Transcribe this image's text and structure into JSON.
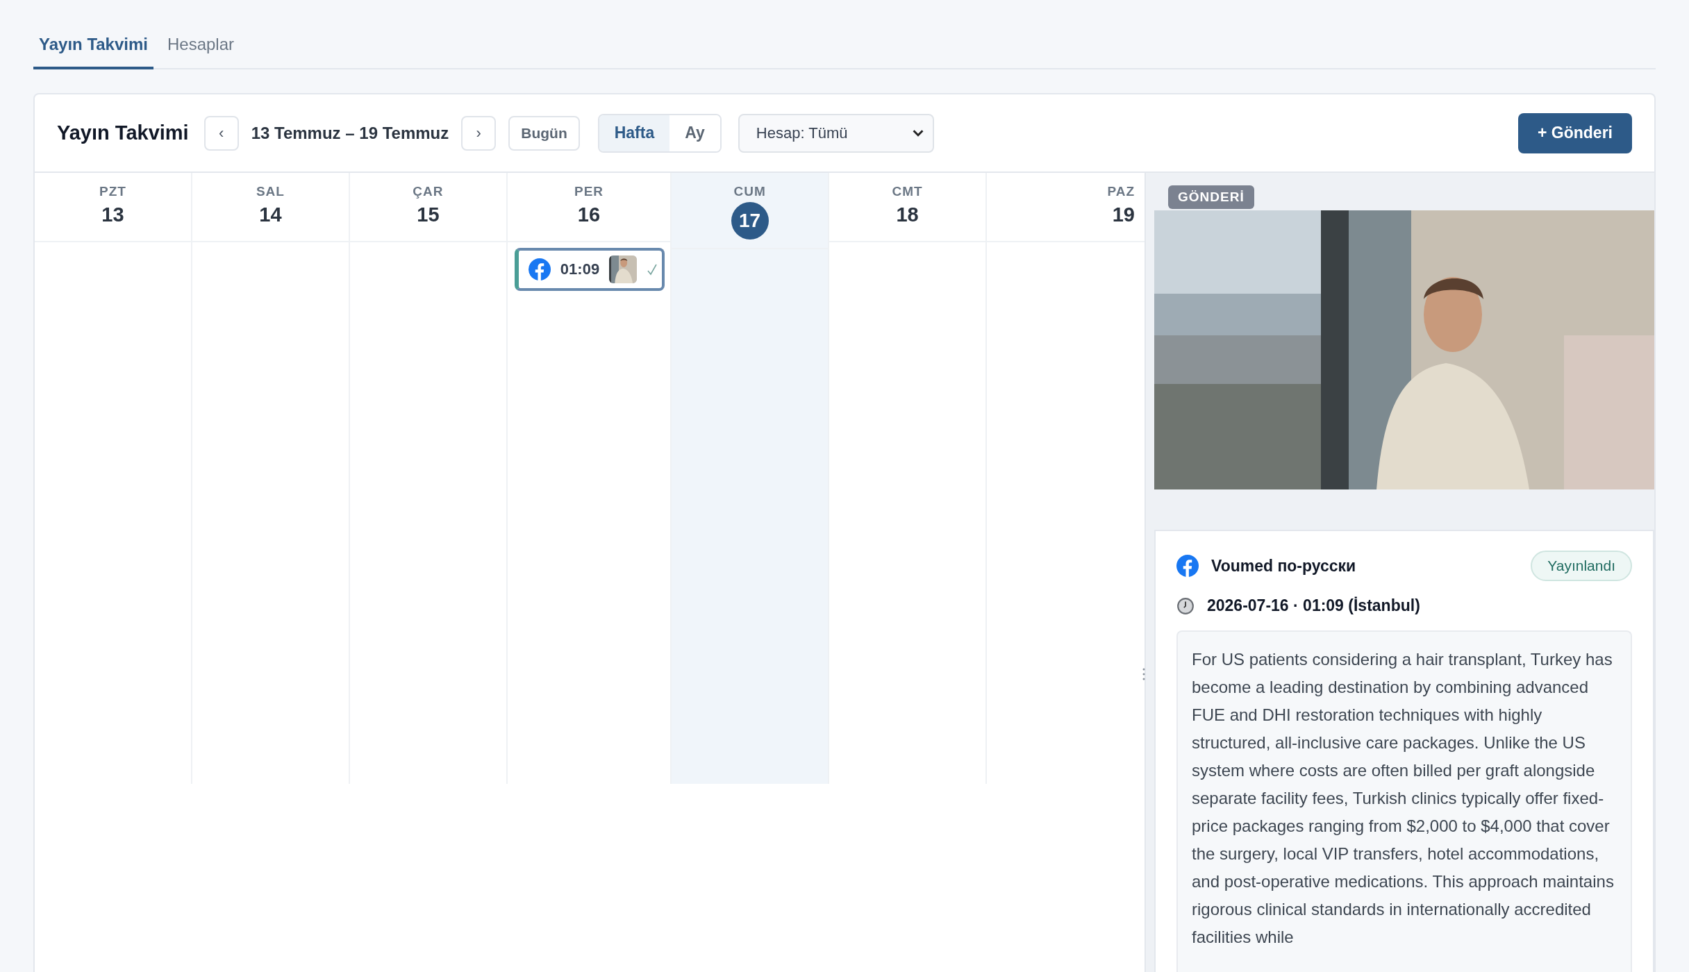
{
  "tabs": [
    {
      "label": "Yayın Takvimi",
      "selected": true
    },
    {
      "label": "Hesaplar",
      "selected": false
    }
  ],
  "toolbar": {
    "title": "Yayın Takvimi",
    "prev": "‹",
    "range": "13 Temmuz – 19 Temmuz",
    "next": "›",
    "today": "Bugün",
    "views": [
      {
        "label": "Hafta",
        "selected": true
      },
      {
        "label": "Ay",
        "selected": false
      }
    ],
    "account_select": "Hesap: Tümü",
    "new_button": "+ Gönderi"
  },
  "days": [
    {
      "dow": "PZT",
      "date": "13",
      "today": false
    },
    {
      "dow": "SAL",
      "date": "14",
      "today": false
    },
    {
      "dow": "ÇAR",
      "date": "15",
      "today": false
    },
    {
      "dow": "PER",
      "date": "16",
      "today": false,
      "events": [
        {
          "time": "01:09",
          "selected": true,
          "published": true
        }
      ]
    },
    {
      "dow": "CUM",
      "date": "17",
      "today": true
    },
    {
      "dow": "CMT",
      "date": "18",
      "today": false
    },
    {
      "dow": "PAZ",
      "date": "19",
      "today": false
    }
  ],
  "detail": {
    "badge": "GÖNDERİ",
    "account": "Voumed по-русски",
    "status": "Yayınlandı",
    "datetime": "2026-07-16 · 01:09 (İstanbul)",
    "body": "For US patients considering a hair transplant, Turkey has become a leading destination by combining advanced FUE and DHI restoration techniques with highly structured, all-inclusive care packages. Unlike the US system where costs are often billed per graft alongside separate facility fees, Turkish clinics typically offer fixed-price packages ranging from $2,000 to $4,000 that cover the surgery, local VIP transfers, hotel accommodations, and post-operative medications. This approach maintains rigorous clinical standards in internationally accredited facilities while"
  }
}
